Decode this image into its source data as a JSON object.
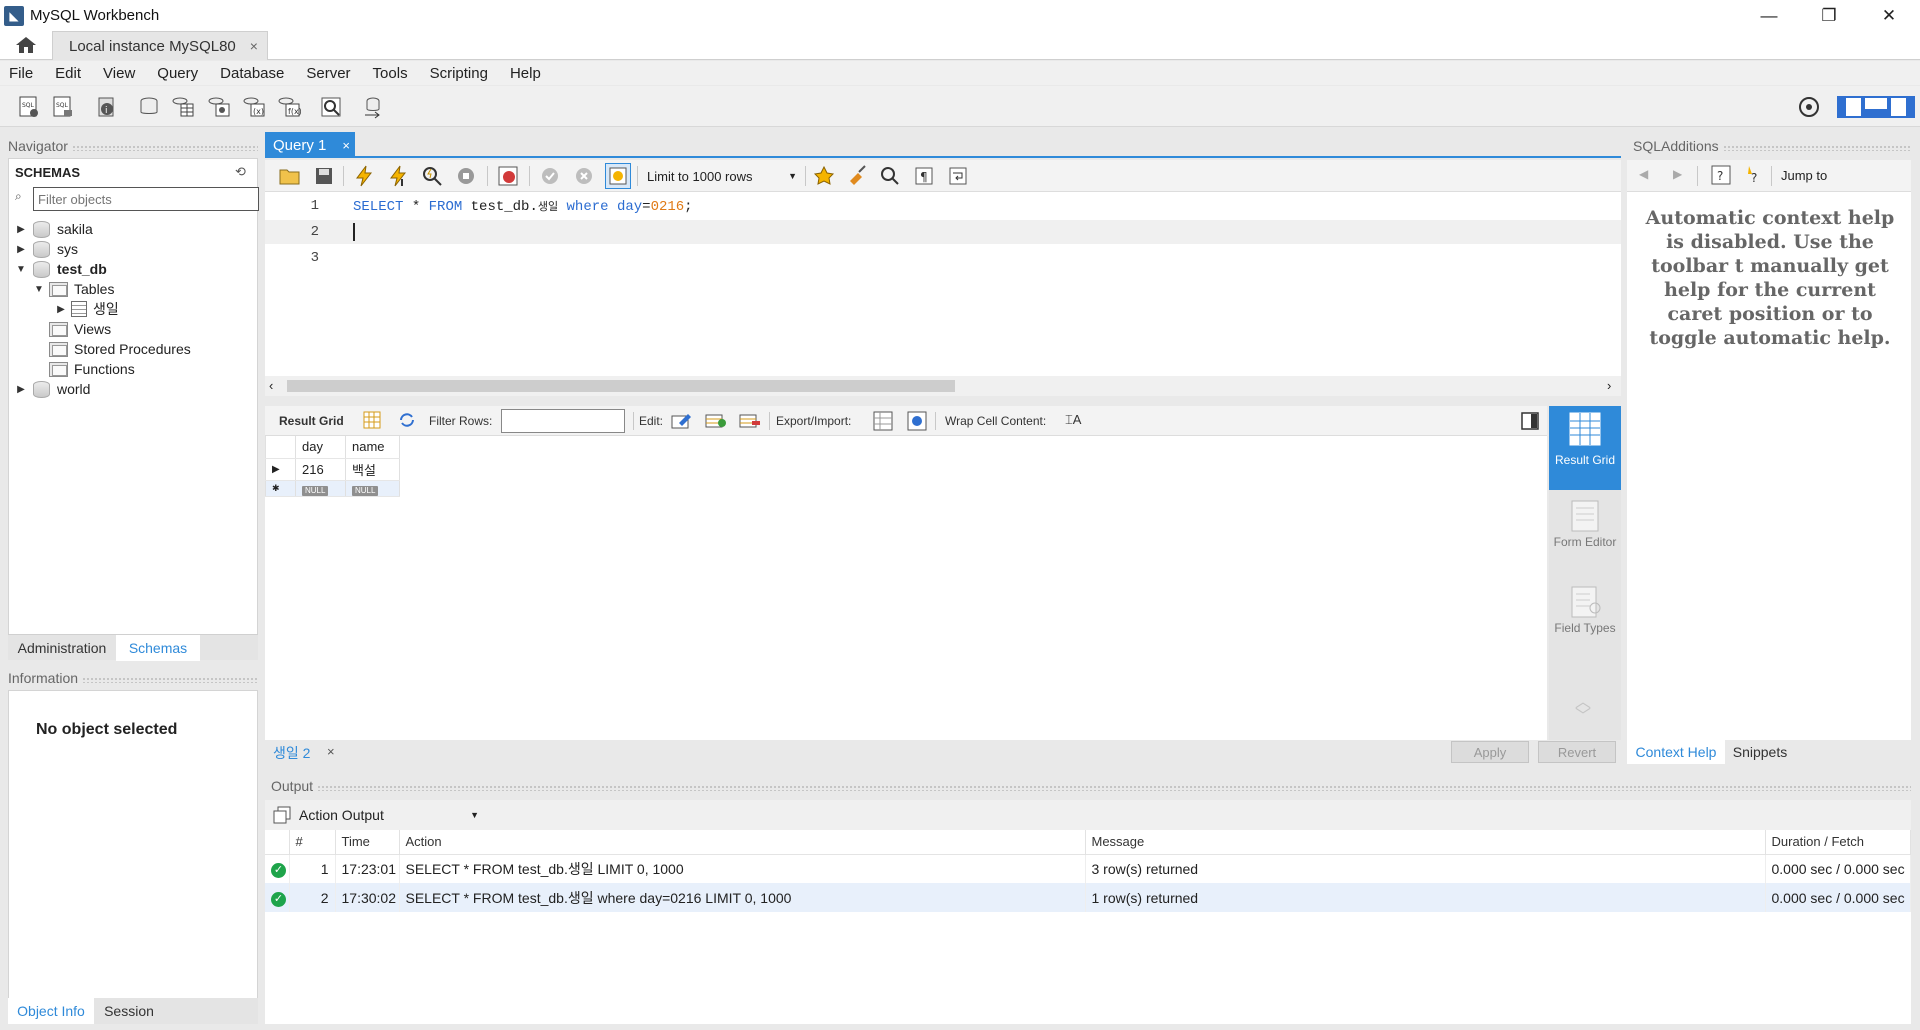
{
  "window": {
    "title": "MySQL Workbench",
    "icon": "workbench-icon"
  },
  "tabs": {
    "home_icon": "home-icon",
    "instance_tab": "Local instance MySQL80",
    "close": "×"
  },
  "menu": [
    "File",
    "Edit",
    "View",
    "Query",
    "Database",
    "Server",
    "Tools",
    "Scripting",
    "Help"
  ],
  "navigator": {
    "header": "Navigator",
    "schemas_label": "SCHEMAS",
    "filter_placeholder": "Filter objects",
    "tree": {
      "sakila": "sakila",
      "sys": "sys",
      "test_db": "test_db",
      "tables": "Tables",
      "table_1": "생일",
      "views": "Views",
      "procs": "Stored Procedures",
      "functions": "Functions",
      "world": "world"
    },
    "tab_admin": "Administration",
    "tab_schemas": "Schemas",
    "info_header": "Information",
    "info_text": "No object selected",
    "tab_objinfo": "Object Info",
    "tab_session": "Session"
  },
  "editor": {
    "tab": "Query 1",
    "limit": "Limit to 1000 rows",
    "lines": [
      "1",
      "2",
      "3"
    ],
    "sql": {
      "kw1": "SELECT",
      "star": " * ",
      "kw2": "FROM",
      "tbl": " test_db.",
      "tblname": "생일",
      "kw3": " where ",
      "col": "day",
      "eq": "=",
      "val": "0216",
      "semi": ";"
    }
  },
  "result_toolbar": {
    "result_grid": "Result Grid",
    "filter_rows": "Filter Rows:",
    "edit": "Edit:",
    "export_import": "Export/Import:",
    "wrap": "Wrap Cell Content:"
  },
  "result_grid": {
    "columns": [
      "day",
      "name"
    ],
    "row": {
      "day": "216",
      "name": "백설"
    },
    "null_label": "NULL"
  },
  "result_side": {
    "result_grid": "Result Grid",
    "form_editor": "Form Editor",
    "field_types": "Field Types"
  },
  "result_tab": {
    "label": "생일 2",
    "close": "×",
    "apply": "Apply",
    "revert": "Revert"
  },
  "sql_additions": {
    "header": "SQLAdditions",
    "jump_to": "Jump to",
    "help_text": "Automatic context help is disabled. Use the toolbar t manually get help for the current caret position or to toggle automatic help.",
    "tab_context": "Context Help",
    "tab_snippets": "Snippets"
  },
  "output": {
    "header": "Output",
    "selector": "Action Output",
    "columns": [
      "#",
      "Time",
      "Action",
      "Message",
      "Duration / Fetch"
    ],
    "rows": [
      {
        "n": "1",
        "time": "17:23:01",
        "action": "SELECT * FROM test_db.생일 LIMIT 0, 1000",
        "message": "3 row(s) returned",
        "duration": "0.000 sec / 0.000 sec"
      },
      {
        "n": "2",
        "time": "17:30:02",
        "action": "SELECT * FROM test_db.생일 where day=0216 LIMIT 0, 1000",
        "message": "1 row(s) returned",
        "duration": "0.000 sec / 0.000 sec"
      }
    ]
  },
  "colors": {
    "accent": "#2f8ad9",
    "keyword": "#2b6cd1",
    "number": "#e07b17",
    "ok": "#1ea44a"
  }
}
